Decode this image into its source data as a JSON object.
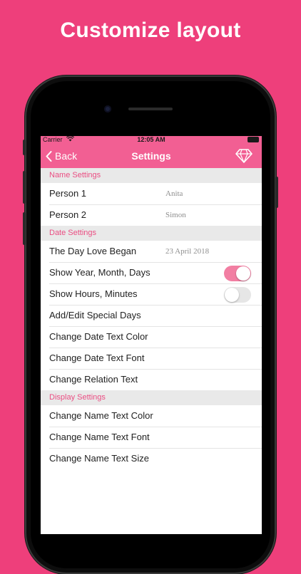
{
  "headline": "Customize layout",
  "status_bar": {
    "carrier": "Carrier",
    "time": "12:05 AM"
  },
  "nav": {
    "back_label": "Back",
    "title": "Settings"
  },
  "sections": {
    "name_settings": {
      "header": "Name Settings",
      "rows": [
        {
          "label": "Person 1",
          "value": "Anita"
        },
        {
          "label": "Person 2",
          "value": "Simon"
        }
      ]
    },
    "date_settings": {
      "header": "Date Settings",
      "rows": [
        {
          "label": "The Day Love Began",
          "value": "23 April 2018"
        },
        {
          "label": "Show Year, Month, Days",
          "toggle": true
        },
        {
          "label": "Show Hours, Minutes",
          "toggle": false
        },
        {
          "label": "Add/Edit Special Days"
        },
        {
          "label": "Change Date Text Color"
        },
        {
          "label": "Change Date Text Font"
        },
        {
          "label": "Change Relation Text"
        }
      ]
    },
    "display_settings": {
      "header": "Display Settings",
      "rows": [
        {
          "label": "Change Name Text Color"
        },
        {
          "label": "Change Name Text Font"
        },
        {
          "label": "Change Name Text Size"
        }
      ]
    }
  },
  "colors": {
    "background": "#ee3f7b",
    "appbar": "#f25f93",
    "section_header_text": "#ea4d82",
    "toggle_on": "#f27ea2"
  }
}
